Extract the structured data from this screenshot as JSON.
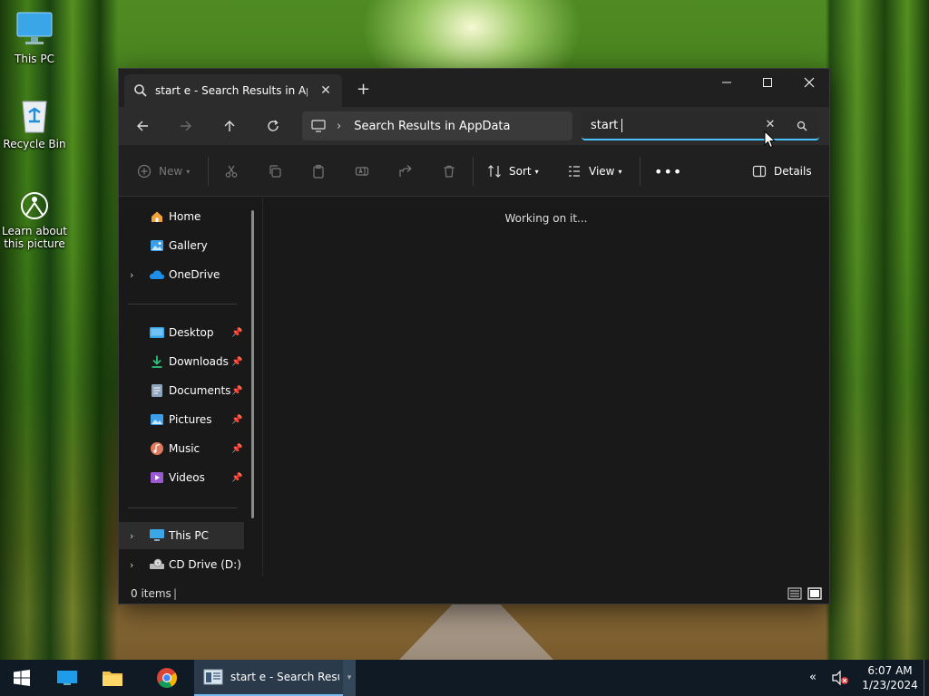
{
  "desktop": {
    "icons": [
      {
        "label": "This PC"
      },
      {
        "label": "Recycle Bin"
      },
      {
        "label": "Learn about this picture"
      }
    ]
  },
  "window": {
    "tab": {
      "title": "start  e - Search Results in AppData"
    },
    "address": {
      "location": "Search Results in AppData"
    },
    "search": {
      "value": "start"
    },
    "toolbar": {
      "new_label": "New",
      "sort_label": "Sort",
      "view_label": "View",
      "details_label": "Details"
    },
    "sidebar": {
      "quick": [
        {
          "label": "Home"
        },
        {
          "label": "Gallery"
        },
        {
          "label": "OneDrive"
        }
      ],
      "pinned": [
        {
          "label": "Desktop"
        },
        {
          "label": "Downloads"
        },
        {
          "label": "Documents"
        },
        {
          "label": "Pictures"
        },
        {
          "label": "Music"
        },
        {
          "label": "Videos"
        }
      ],
      "drives": [
        {
          "label": "This PC"
        },
        {
          "label": "CD Drive (D:)"
        }
      ]
    },
    "content": {
      "status_message": "Working on it..."
    },
    "statusbar": {
      "items_count": "0 items",
      "separator": "|"
    }
  },
  "taskbar": {
    "active_app_label": "start  e - Search Resul...",
    "clock": {
      "time": "6:07 AM",
      "date": "1/23/2024"
    }
  },
  "colors": {
    "accent": "#4cc2ff",
    "window_bg": "#191919",
    "taskbar_bg": "#0f1a24"
  }
}
